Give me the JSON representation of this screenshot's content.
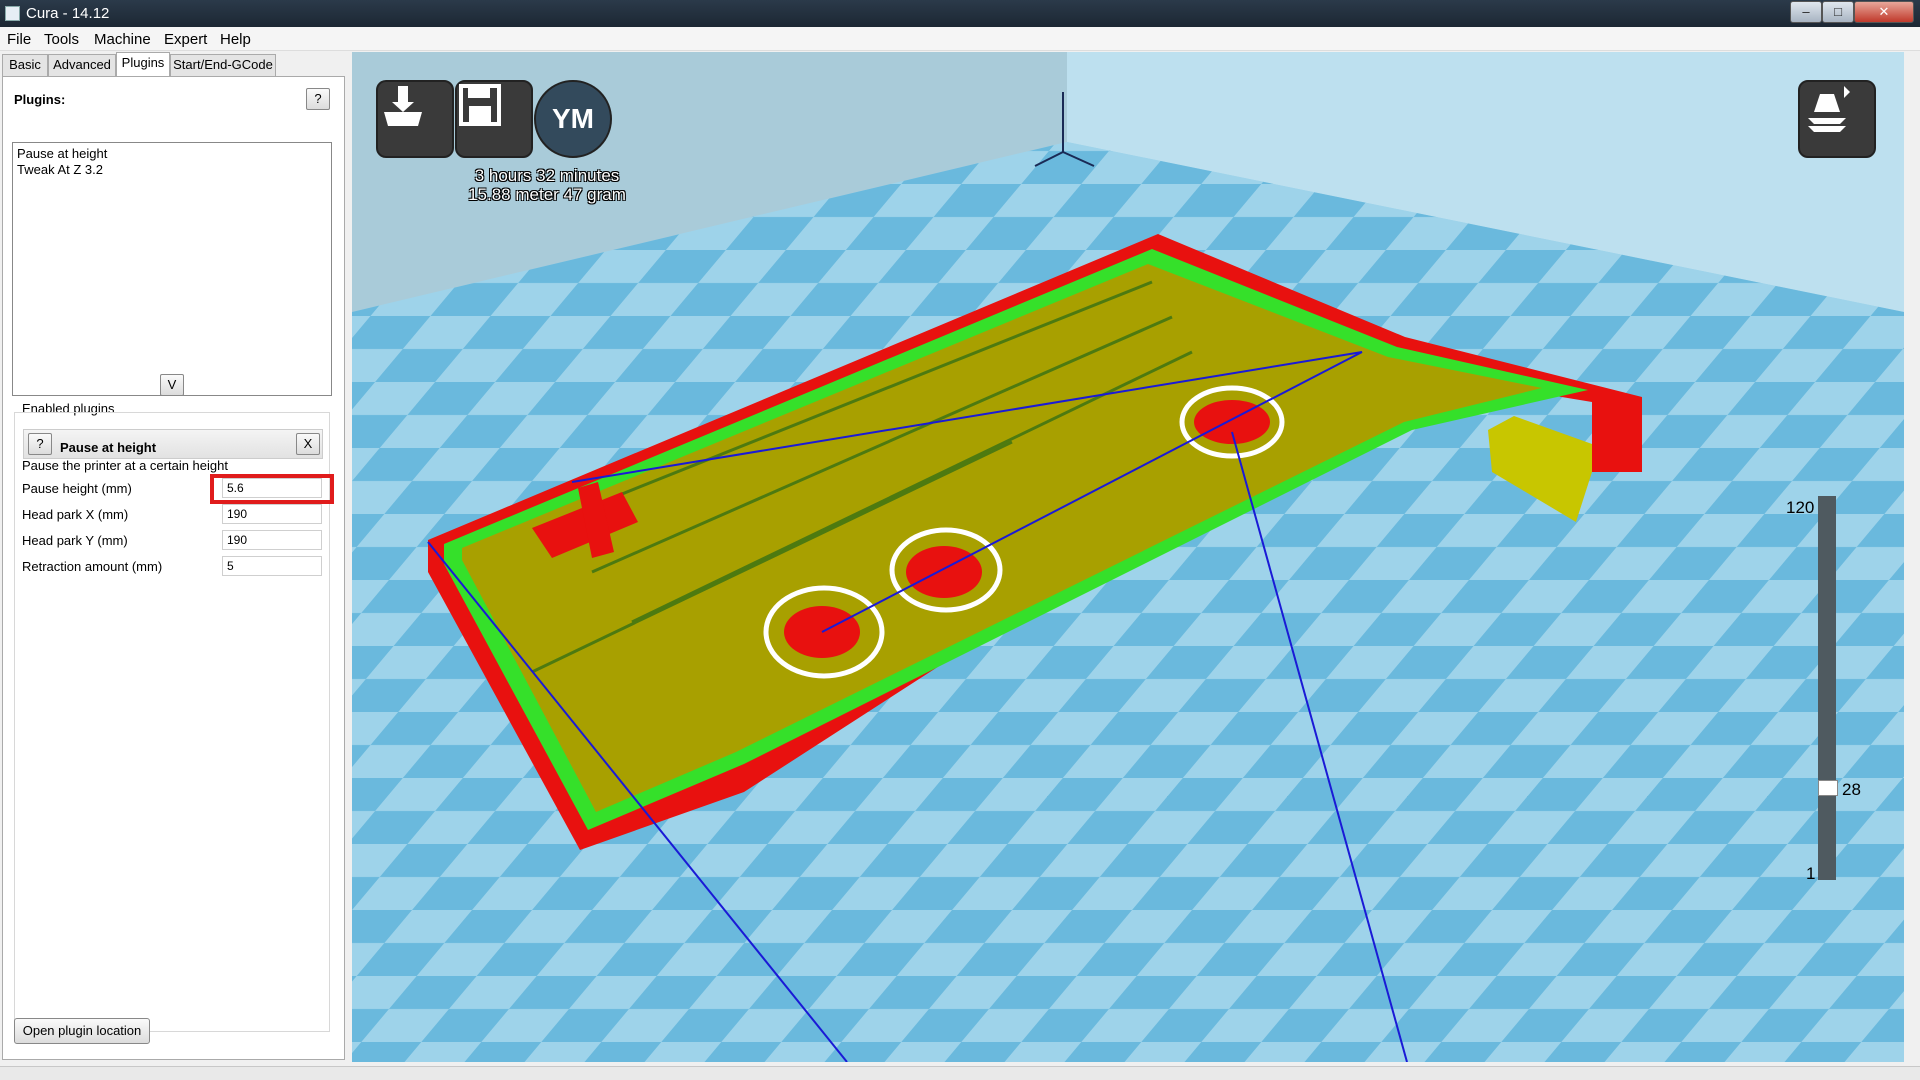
{
  "window": {
    "title": "Cura - 14.12",
    "minimize": "–",
    "maximize": "□",
    "close": "✕"
  },
  "menu": [
    "File",
    "Tools",
    "Machine",
    "Expert",
    "Help"
  ],
  "tabs": [
    "Basic",
    "Advanced",
    "Plugins",
    "Start/End-GCode"
  ],
  "active_tab": "Plugins",
  "plugins_panel": {
    "label": "Plugins:",
    "help_btn": "?",
    "available": [
      "Pause at height",
      "Tweak At Z 3.2"
    ],
    "expand_btn": "V",
    "enabled_label": "Enabled plugins",
    "plugin": {
      "help_btn": "?",
      "name": "Pause at height",
      "remove_btn": "X",
      "description": "Pause the printer at a certain height",
      "params": [
        {
          "label": "Pause height (mm)",
          "value": "5.6"
        },
        {
          "label": "Head park X (mm)",
          "value": "190"
        },
        {
          "label": "Head park Y (mm)",
          "value": "190"
        },
        {
          "label": "Retraction amount (mm)",
          "value": "5"
        }
      ]
    },
    "open_location_btn": "Open plugin location"
  },
  "viewport": {
    "stats_time": "3 hours 32 minutes",
    "stats_material": "15.88 meter 47 gram",
    "ym_label": "YM",
    "icons": [
      "load-model-icon",
      "save-toolpath-icon",
      "youmagine-icon",
      "view-mode-icon"
    ],
    "layer_slider": {
      "max": "120",
      "current": "28",
      "min": "1",
      "current_fraction": 0.227
    },
    "colors": {
      "bed": "#9ed3ea",
      "outer_wall": "#e8110f",
      "inner_wall": "#35e02a",
      "infill": "#a8a000",
      "travel": "#1a1ad6",
      "circle": "#ffffff"
    }
  }
}
